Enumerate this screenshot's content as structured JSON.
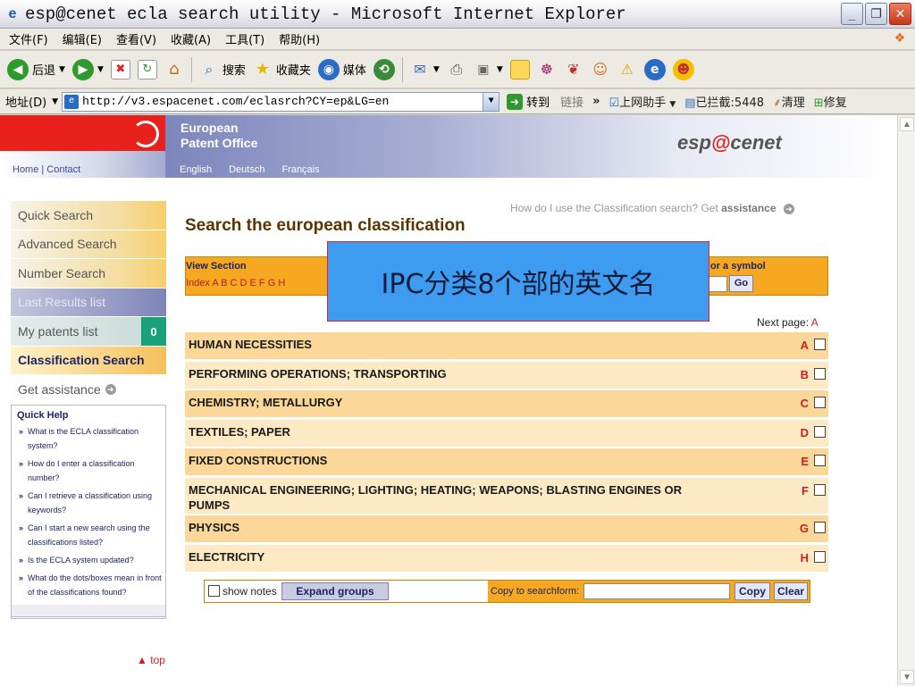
{
  "window": {
    "title": "esp@cenet ecla search utility - Microsoft Internet Explorer"
  },
  "menu": [
    "文件(F)",
    "编辑(E)",
    "查看(V)",
    "收藏(A)",
    "工具(T)",
    "帮助(H)"
  ],
  "toolbar": {
    "back": "后退",
    "search": "搜索",
    "favorites": "收藏夹",
    "media": "媒体"
  },
  "address": {
    "label": "地址(D)",
    "url": "http://v3.espacenet.com/eclasrch?CY=ep&LG=en",
    "go": "转到",
    "links": "链接",
    "helper": "上网助手",
    "blocked": "已拦截:5448",
    "clean": "清理",
    "repair": "修复"
  },
  "header": {
    "org_line1": "European",
    "org_line2": "Patent Office",
    "brand_prefix": "esp",
    "brand_at": "@",
    "brand_suffix": "cenet",
    "home_contact": "Home | Contact",
    "languages": [
      "English",
      "Deutsch",
      "Français"
    ]
  },
  "nav": {
    "quick_search": "Quick Search",
    "advanced_search": "Advanced Search",
    "number_search": "Number Search",
    "last_results": "Last Results list",
    "my_patents": "My patents list",
    "my_patents_count": "0",
    "classification_search": "Classification Search",
    "get_assistance": "Get assistance"
  },
  "quick_help": {
    "title": "Quick Help",
    "items": [
      "What is the ECLA classification system?",
      "How do I enter a classification number?",
      "Can I retrieve a classification using keywords?",
      "Can I start a new search using the classifications listed?",
      "Is the ECLA system updated?",
      "What do the dots/boxes mean in front of the classifications found?"
    ]
  },
  "main": {
    "howto_text": "How do I use the Classification search? Get",
    "howto_link": "assistance",
    "title": "Search the european classification",
    "view_section_label": "View Section",
    "index_text": "Index A B C D E F G H",
    "symbol_label": "or a symbol",
    "go_label": "Go",
    "next_page_label": "Next page:",
    "next_page_value": "A",
    "sections": [
      {
        "name": "HUMAN NECESSITIES",
        "letter": "A"
      },
      {
        "name": "PERFORMING OPERATIONS; TRANSPORTING",
        "letter": "B"
      },
      {
        "name": "CHEMISTRY; METALLURGY",
        "letter": "C"
      },
      {
        "name": "TEXTILES; PAPER",
        "letter": "D"
      },
      {
        "name": "FIXED CONSTRUCTIONS",
        "letter": "E"
      },
      {
        "name": "MECHANICAL ENGINEERING; LIGHTING; HEATING; WEAPONS; BLASTING ENGINES OR PUMPS",
        "letter": "F"
      },
      {
        "name": "PHYSICS",
        "letter": "G"
      },
      {
        "name": "ELECTRICITY",
        "letter": "H"
      }
    ],
    "show_notes": "show notes",
    "expand_groups": "Expand groups",
    "copy_label": "Copy to searchform:",
    "copy_button": "Copy",
    "clear_button": "Clear",
    "top_link": "▲ top"
  },
  "overlay": {
    "text": "IPC分类8个部的英文名"
  },
  "colors": {
    "epo_red": "#e8211c",
    "orange": "#f6a821",
    "row_light": "#fde9c4",
    "row_dark": "#fbd89a",
    "overlay_blue": "#3d9cf0"
  }
}
